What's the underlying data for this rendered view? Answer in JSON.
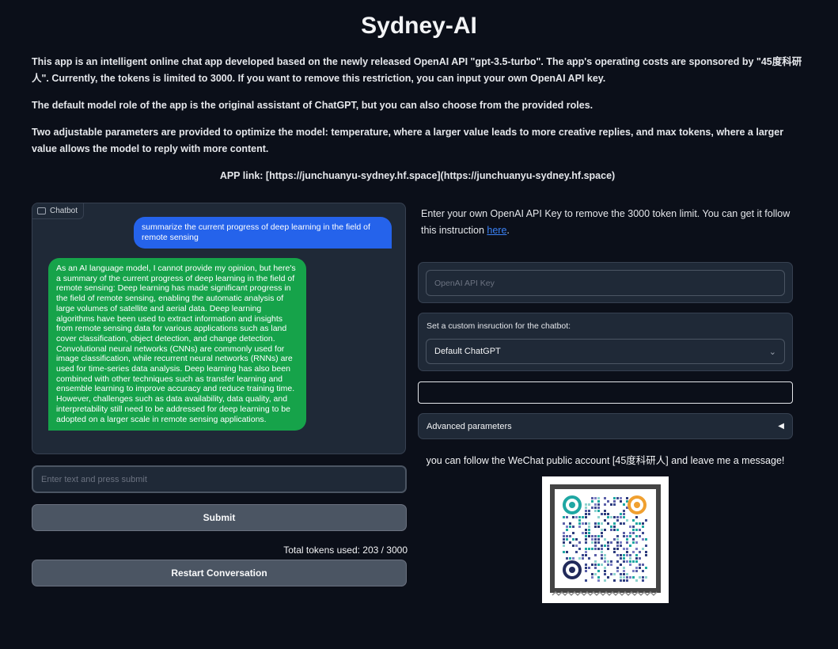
{
  "title": "Sydney-AI",
  "intro": {
    "p1": "This app is an intelligent online chat app developed based on the newly released OpenAI API \"gpt-3.5-turbo\". The app's operating costs are sponsored by \"45度科研人\". Currently, the tokens is limited to 3000. If you want to remove this restriction, you can input your own OpenAI API key.",
    "p2": "The default model role of the app is the original assistant of ChatGPT, but you can also choose from the provided roles.",
    "p3": "Two adjustable parameters are provided to optimize the model: temperature, where a larger value leads to more creative replies, and max tokens, where a larger value allows the model to reply with more content.",
    "app_link": "APP link: [https://junchuanyu-sydney.hf.space](https://junchuanyu-sydney.hf.space)"
  },
  "chatbot": {
    "label": "Chatbot",
    "user_message": "summarize the current progress of deep learning in the field of remote sensing",
    "bot_message": "As an AI language model, I cannot provide my opinion, but here's a summary of the current progress of deep learning in the field of remote sensing: Deep learning has made significant progress in the field of remote sensing, enabling the automatic analysis of large volumes of satellite and aerial data. Deep learning algorithms have been used to extract information and insights from remote sensing data for various applications such as land cover classification, object detection, and change detection. Convolutional neural networks (CNNs) are commonly used for image classification, while recurrent neural networks (RNNs) are used for time-series data analysis. Deep learning has also been combined with other techniques such as transfer learning and ensemble learning to improve accuracy and reduce training time. However, challenges such as data availability, data quality, and interpretability still need to be addressed for deep learning to be adopted on a larger scale in remote sensing applications."
  },
  "input": {
    "placeholder": "Enter text and press submit",
    "value": ""
  },
  "buttons": {
    "submit": "Submit",
    "restart": "Restart Conversation"
  },
  "tokens": {
    "text": "Total tokens used: 203 / 3000"
  },
  "api": {
    "info": "Enter your own OpenAI API Key to remove the 3000 token limit. You can get it follow this instruction ",
    "link": "here",
    "info_end": ".",
    "placeholder": "OpenAI API Key"
  },
  "instruction": {
    "label": "Set a custom insruction for the chatbot:",
    "selected": "Default ChatGPT"
  },
  "advanced": {
    "label": "Advanced parameters"
  },
  "wechat": {
    "text": "you can follow the WeChat public account [45度科研人] and leave me a message!"
  },
  "colors": {
    "background": "#0b0f19",
    "user_bubble": "#2563eb",
    "bot_bubble": "#16a34a",
    "link": "#3b82f6"
  }
}
